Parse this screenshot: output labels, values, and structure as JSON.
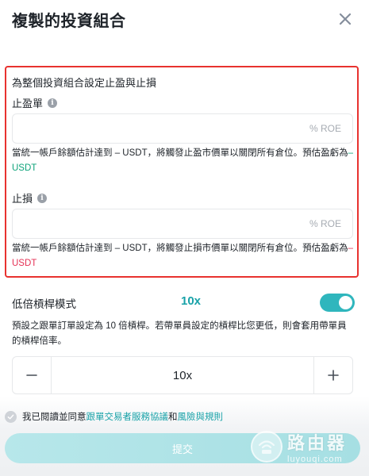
{
  "header": {
    "title": "複製的投資組合"
  },
  "highlight_color": "#e8322f",
  "accent_color": "#18a2a8",
  "tpsl": {
    "description": "為整個投資組合設定止盈與止損",
    "take_profit": {
      "label": "止盈單",
      "value": "",
      "unit": "% ROE",
      "hint_prefix": "當統一帳戶餘額估計達到 – USDT，將觸發止盈市價單以關閉所有倉位。預估盈虧為",
      "hint_amount": "– USDT"
    },
    "stop_loss": {
      "label": "止損",
      "value": "",
      "unit": "% ROE",
      "hint_prefix": "當統一帳戶餘額估計達到 – USDT，將觸發止損市價單以關閉所有倉位。預估盈虧為",
      "hint_amount": "– USDT"
    }
  },
  "leverage": {
    "label": "低倍槓桿模式",
    "value": "10x",
    "enabled": true,
    "description": "預設之跟單訂單設定為 10 倍槓桿。若帶單員設定的槓桿比您更低，則會套用帶單員的槓桿倍率。",
    "stepper_value": "10x",
    "minus": "−",
    "plus": "+"
  },
  "agreement": {
    "prefix": "我已閱讀並同意",
    "link1": "跟單交易者服務協議",
    "conj": "和",
    "link2": "風險與規則"
  },
  "submit": {
    "label": "提交"
  },
  "watermark": {
    "cn": "路由器",
    "en": "luyouqi.com"
  }
}
